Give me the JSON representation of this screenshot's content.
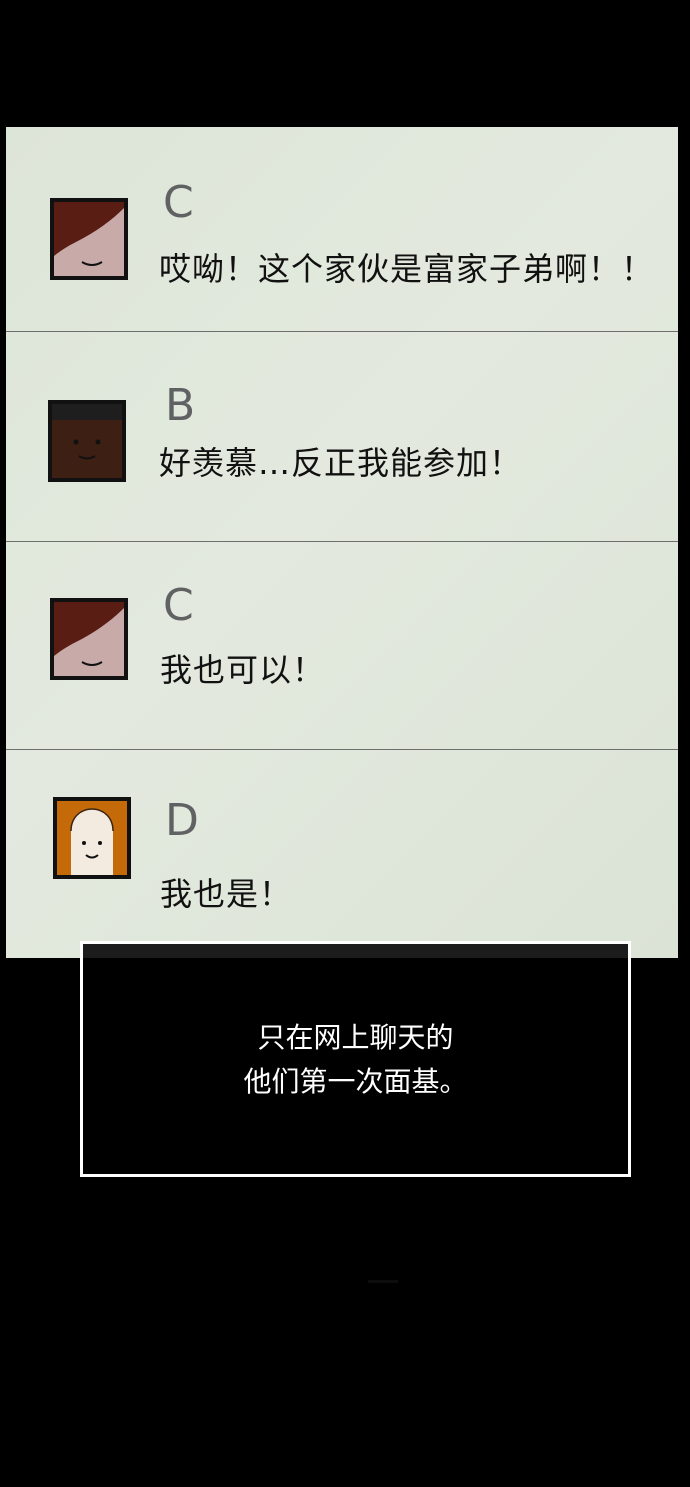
{
  "chat": {
    "messages": [
      {
        "sender": "C",
        "text": "哎呦！这个家伙是富家子弟啊！！",
        "avatar": "red-hair-avatar-icon"
      },
      {
        "sender": "B",
        "text": "好羡慕…反正我能参加！",
        "avatar": "dark-skin-avatar-icon"
      },
      {
        "sender": "C",
        "text": "我也可以！",
        "avatar": "red-hair-avatar-icon"
      },
      {
        "sender": "D",
        "text": "我也是！",
        "avatar": "orange-hair-avatar-icon"
      }
    ]
  },
  "caption": {
    "line1": "只在网上聊天的",
    "line2": "他们第一次面基。"
  },
  "colors": {
    "panel_bg": "#dde5d8",
    "divider": "#6e6e6e",
    "sender_text": "#5f6163",
    "message_text": "#111111",
    "caption_border": "#ffffff",
    "page_bg": "#000000",
    "red_hair": "#5a1d14",
    "pink_skin": "#c8aaa8",
    "dark_skin": "#3e1f14",
    "orange_hair": "#c46a08",
    "light_skin": "#f4ebe0"
  }
}
